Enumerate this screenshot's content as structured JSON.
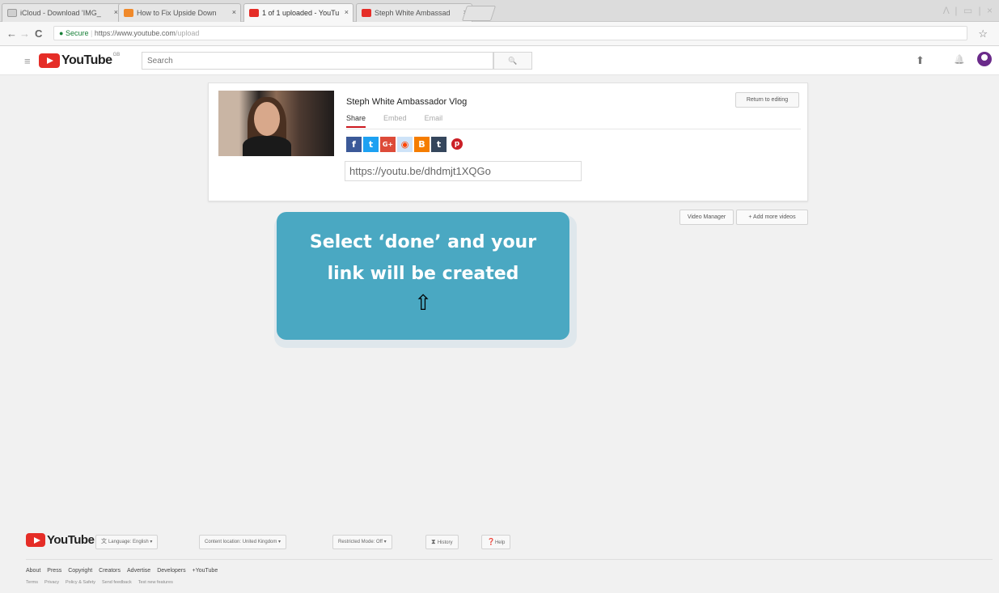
{
  "browser": {
    "tabs": [
      {
        "label": "iCloud - Download 'IMG_",
        "favicon_color": "#cfcfcf"
      },
      {
        "label": "How to Fix Upside Down",
        "favicon_color": "#f0892a"
      },
      {
        "label": "1 of 1 uploaded - YouTu",
        "favicon_color": "#e52d27"
      },
      {
        "label": "Steph White Ambassad",
        "favicon_color": "#e52d27"
      }
    ],
    "tab_close": "×",
    "secure_label": "Secure",
    "url_host": "https://www.youtube.com",
    "url_path": "/upload",
    "back_icon": "←",
    "forward_icon": "→",
    "reload_icon": "C",
    "bookmark_icon": "☆",
    "window_controls": "Λ | ▭ | ×"
  },
  "header": {
    "logo_text": "YouTube",
    "logo_sup": "GB",
    "search_placeholder": "Search",
    "search_icon": "🔍",
    "menu_icon": "≡",
    "upload_icon": "⬆",
    "bell_icon": "🔔"
  },
  "share_card": {
    "video_title": "Steph White Ambassador Vlog",
    "tabs": [
      "Share",
      "Embed",
      "Email"
    ],
    "active_tab": "Share",
    "return_button": "Return to editing",
    "socials": [
      {
        "name": "facebook-icon",
        "glyph": "f",
        "color": "#3b5998"
      },
      {
        "name": "twitter-icon",
        "glyph": "t",
        "color": "#1da1f2"
      },
      {
        "name": "google-plus-icon",
        "glyph": "G+",
        "color": "#dd4b39"
      },
      {
        "name": "reddit-icon",
        "glyph": "◉",
        "color": "#cee3f8"
      },
      {
        "name": "blogger-icon",
        "glyph": "B",
        "color": "#f57d00"
      },
      {
        "name": "tumblr-icon",
        "glyph": "t",
        "color": "#35465c"
      },
      {
        "name": "pinterest-icon",
        "glyph": "p",
        "color": "#cb2027"
      }
    ],
    "share_link": "https://youtu.be/dhdmjt1XQGo"
  },
  "actions": {
    "video_manager": "Video Manager",
    "add_more_videos": "+ Add more videos"
  },
  "callout": {
    "line1": "Select ‘done’ and your",
    "line2": "link will be created",
    "arrow": "⇧"
  },
  "footer": {
    "logo_text": "YouTube",
    "language": "Language: English ▾",
    "content_location": "Content location: United Kingdom ▾",
    "restricted_mode": "Restricted Mode: Off ▾",
    "history": "History",
    "help": "Help",
    "links": [
      "About",
      "Press",
      "Copyright",
      "Creators",
      "Advertise",
      "Developers",
      "+YouTube"
    ],
    "sublinks": [
      "Terms",
      "Privacy",
      "Policy & Safety",
      "Send feedback",
      "Test new features"
    ]
  }
}
